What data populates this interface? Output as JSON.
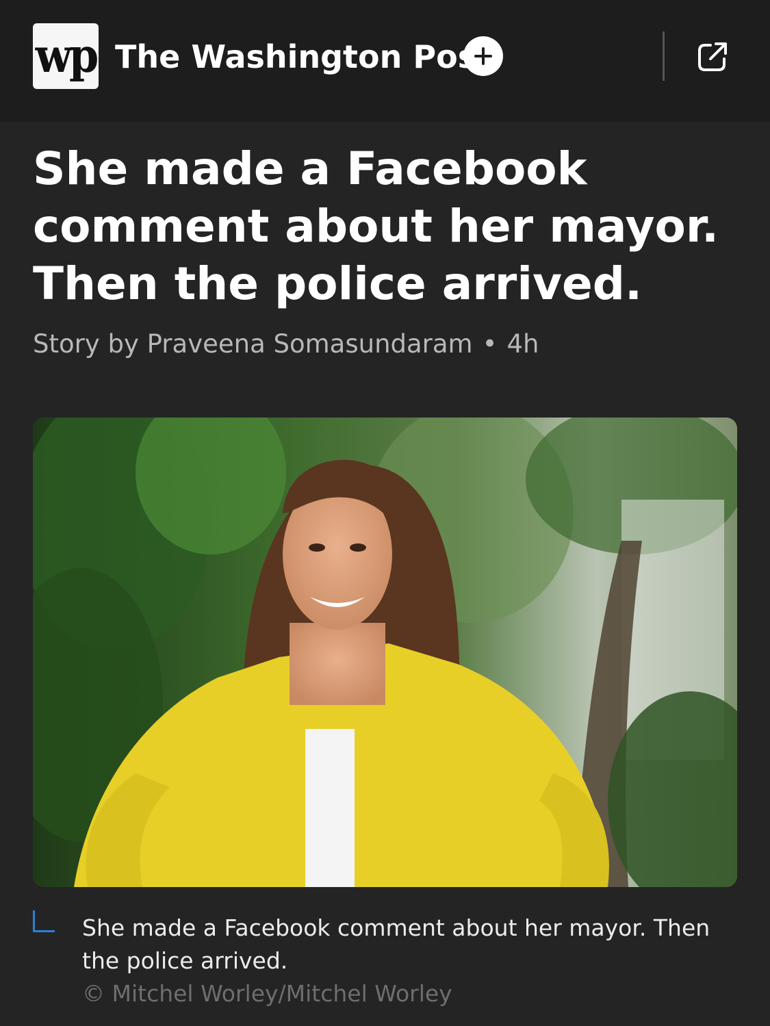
{
  "header": {
    "logo_label": "wp",
    "publisher_name": "The Washington Post",
    "follow_icon": "plus-icon",
    "open_icon": "external-link-icon"
  },
  "article": {
    "headline": "She made a Facebook comment about her mayor. Then the police arrived.",
    "byline_author": "Story by Praveena Somasundaram",
    "byline_separator": "•",
    "byline_time": "4h",
    "image": {
      "caption": "She made a Facebook comment about her mayor. Then the police arrived.",
      "credit": "© Mitchel Worley/Mitchel Worley"
    }
  },
  "colors": {
    "background": "#242424",
    "header_background": "#1d1d1d",
    "caption_accent": "#2b7fd6"
  }
}
